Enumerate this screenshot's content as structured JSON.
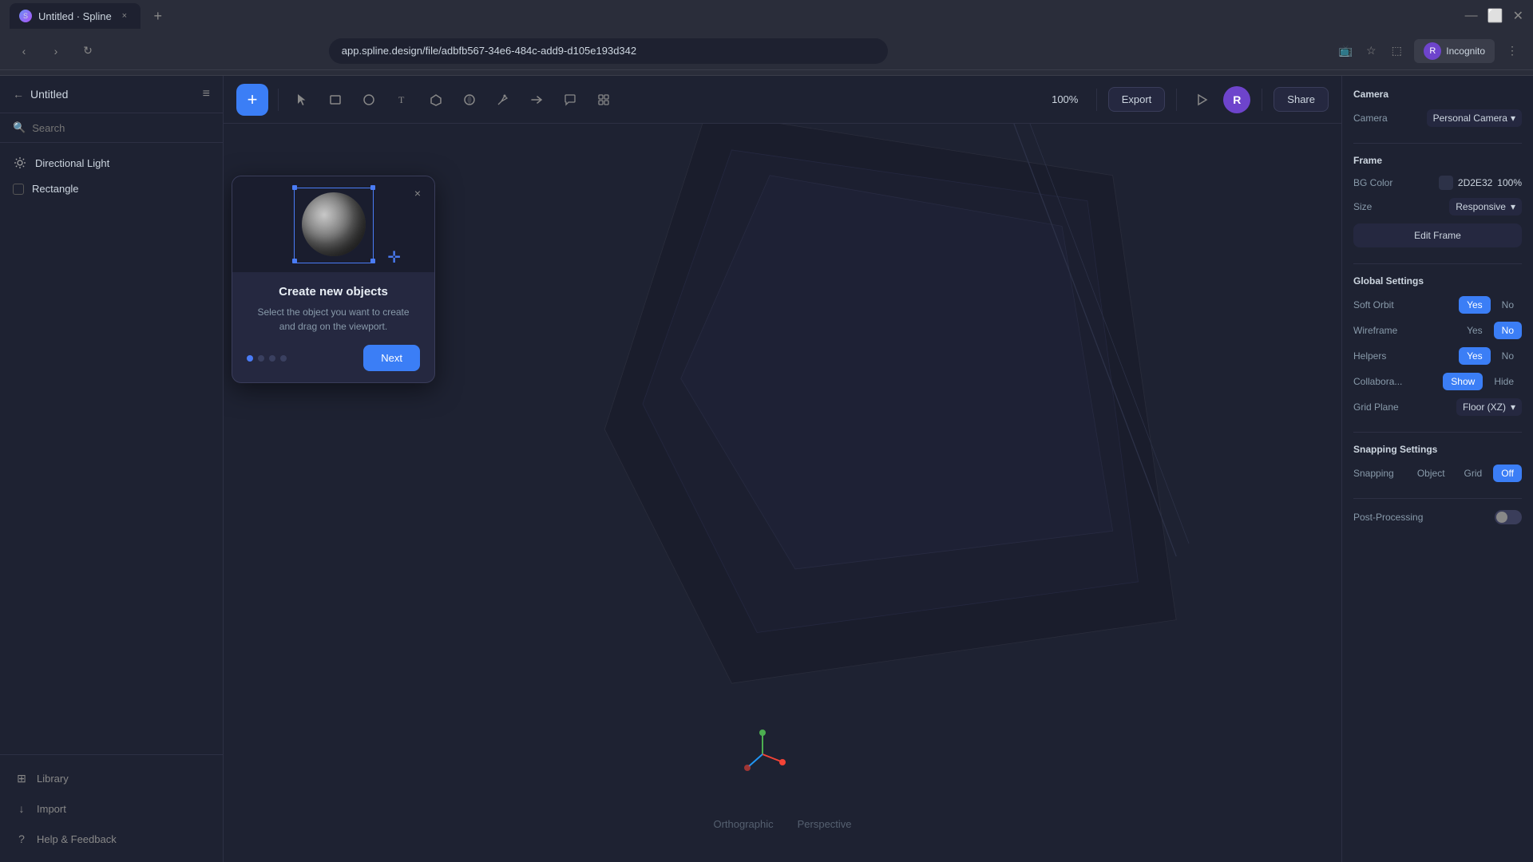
{
  "browser": {
    "tab_title": "Untitled · Spline",
    "tab_close": "×",
    "tab_new": "+",
    "address": "app.spline.design/file/adbfb567-34e6-484c-add9-d105e193d342",
    "incognito_label": "Incognito",
    "incognito_initial": "R"
  },
  "sidebar": {
    "back_icon": "←",
    "title": "Untitled",
    "menu_icon": "≡",
    "search_placeholder": "Search",
    "items": [
      {
        "id": "directional-light",
        "label": "Directional Light",
        "icon": "💡",
        "type": "light"
      },
      {
        "id": "rectangle",
        "label": "Rectangle",
        "icon": "□",
        "type": "shape"
      }
    ],
    "footer": [
      {
        "id": "library",
        "label": "Library",
        "icon": "⊞"
      },
      {
        "id": "import",
        "label": "Import",
        "icon": "↓"
      },
      {
        "id": "help",
        "label": "Help & Feedback",
        "icon": "?"
      }
    ]
  },
  "toolbar": {
    "add_label": "+",
    "zoom": "100%",
    "export_label": "Export",
    "play_icon": "▷",
    "user_initial": "R",
    "share_label": "Share",
    "tools": [
      {
        "id": "select",
        "icon": "✦"
      },
      {
        "id": "rectangle-tool",
        "icon": "▭"
      },
      {
        "id": "circle-tool",
        "icon": "○"
      },
      {
        "id": "text-tool",
        "icon": "T"
      },
      {
        "id": "3d-tool",
        "icon": "◈"
      },
      {
        "id": "pen-tool",
        "icon": "⬡"
      },
      {
        "id": "path-tool",
        "icon": "✒"
      },
      {
        "id": "frame-tool",
        "icon": "⌂"
      },
      {
        "id": "comment-tool",
        "icon": "◯"
      },
      {
        "id": "ui-tool",
        "icon": "⬚"
      }
    ]
  },
  "tutorial": {
    "close_icon": "×",
    "title": "Create new objects",
    "description": "Select the object you want to create\nand drag on the viewport.",
    "next_label": "Next",
    "dots": [
      {
        "id": "dot1",
        "active": true
      },
      {
        "id": "dot2",
        "active": false
      },
      {
        "id": "dot3",
        "active": false
      },
      {
        "id": "dot4",
        "active": false
      }
    ]
  },
  "viewport": {
    "view_orthographic": "Orthographic",
    "view_perspective": "Perspective"
  },
  "right_panel": {
    "camera_section": "Camera",
    "camera_label": "Camera",
    "camera_value": "Personal Camera",
    "frame_section": "Frame",
    "bg_color_label": "BG Color",
    "bg_color_hex": "2D2E32",
    "bg_color_opacity": "100%",
    "size_label": "Size",
    "size_value": "Responsive",
    "edit_frame_label": "Edit Frame",
    "global_settings_section": "Global Settings",
    "soft_orbit_label": "Soft Orbit",
    "soft_orbit_yes": "Yes",
    "soft_orbit_no": "No",
    "wireframe_label": "Wireframe",
    "wireframe_yes": "Yes",
    "wireframe_no": "No",
    "helpers_label": "Helpers",
    "helpers_yes": "Yes",
    "helpers_no": "No",
    "collaboration_label": "Collabora...",
    "collab_show": "Show",
    "collab_hide": "Hide",
    "grid_plane_label": "Grid Plane",
    "grid_plane_value": "Floor (XZ)",
    "snapping_section": "Snapping Settings",
    "snapping_label": "Snapping",
    "snapping_object": "Object",
    "snapping_grid": "Grid",
    "snapping_off": "Off",
    "post_processing_label": "Post-Processing"
  }
}
